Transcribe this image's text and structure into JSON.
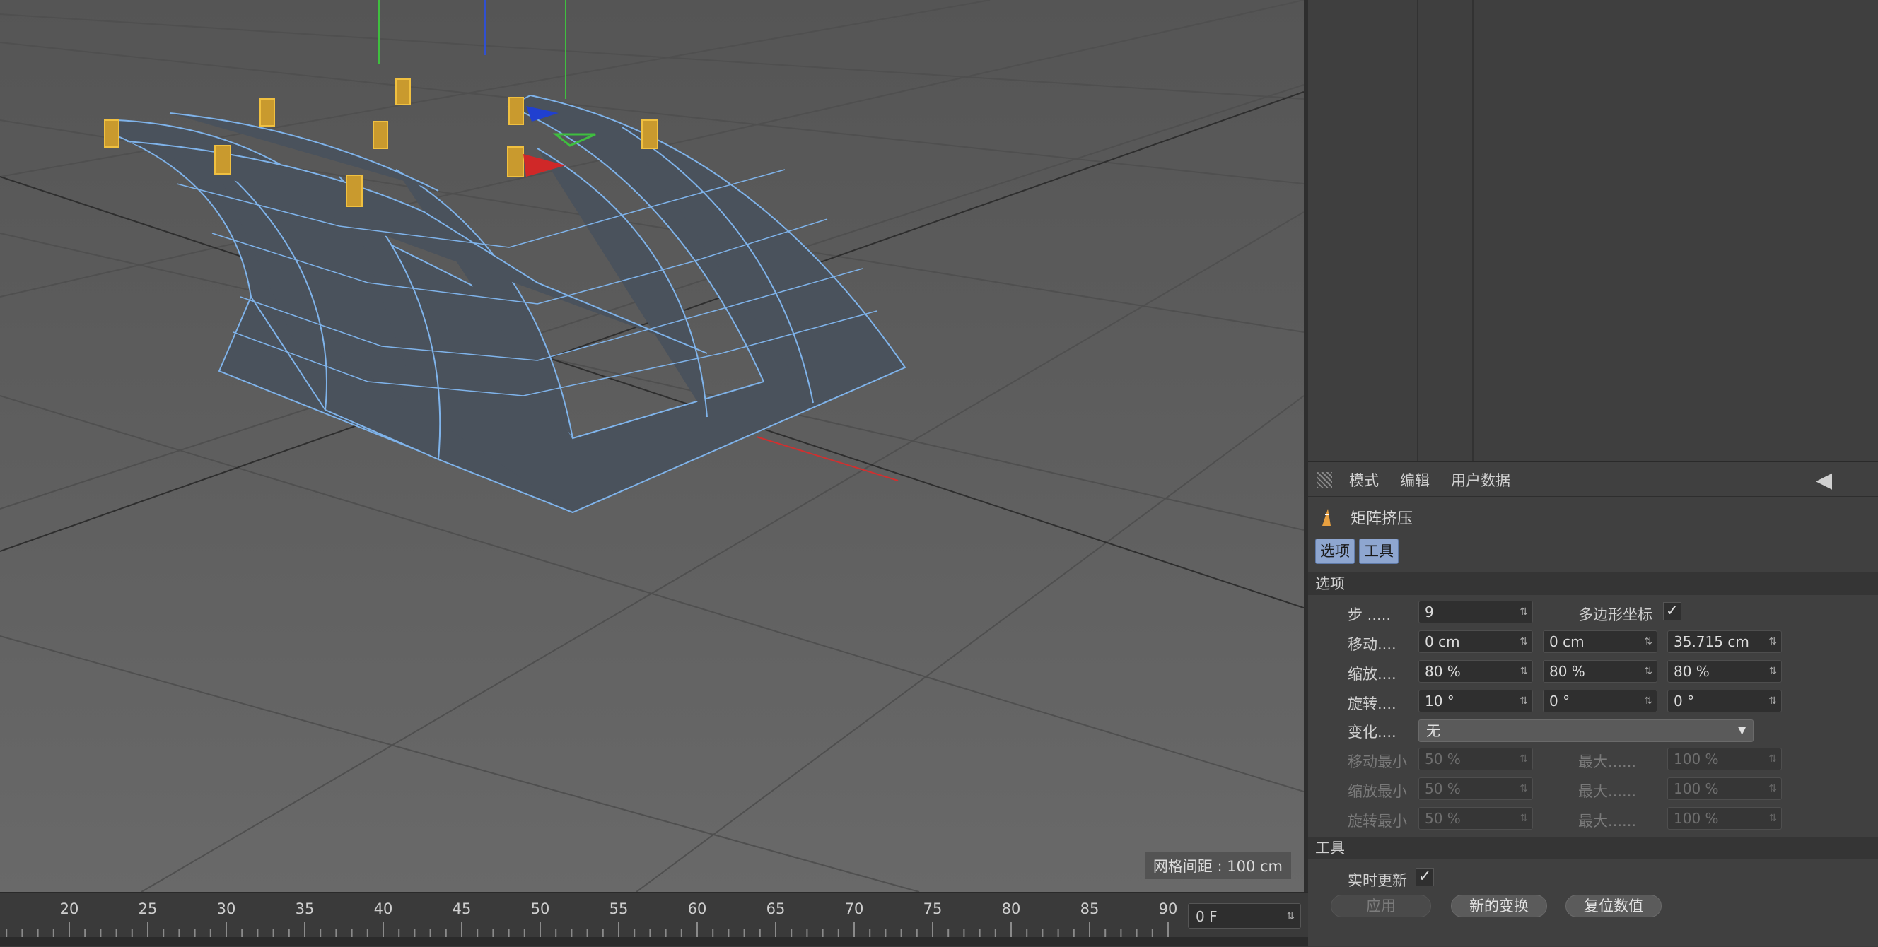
{
  "viewport": {
    "grid_spacing_label": "网格间距 : 100 cm"
  },
  "timeline": {
    "ticks": [
      "20",
      "25",
      "30",
      "35",
      "40",
      "45",
      "50",
      "55",
      "60",
      "65",
      "70",
      "75",
      "80",
      "85",
      "90"
    ],
    "current_frame": "0 F"
  },
  "attributes": {
    "menu": [
      "模式",
      "编辑",
      "用户数据"
    ],
    "object_title": "矩阵挤压",
    "tabs": [
      "选项",
      "工具"
    ],
    "options_header": "选项",
    "steps_label": "步 .....",
    "steps_value": "9",
    "poly_coords_label": "多边形坐标",
    "poly_coords_checked": "✓",
    "move_label": "移动....",
    "move_values": [
      "0 cm",
      "0 cm",
      "35.715 cm"
    ],
    "scale_label": "缩放....",
    "scale_values": [
      "80 %",
      "80 %",
      "80 %"
    ],
    "rotate_label": "旋转....",
    "rotate_values": [
      "10 °",
      "0 °",
      "0 °"
    ],
    "variation_label": "变化....",
    "variation_value": "无",
    "move_min_label": "移动最小",
    "move_min_value": "50 %",
    "scale_min_label": "缩放最小",
    "scale_min_value": "50 %",
    "rotate_min_label": "旋转最小",
    "rotate_min_value": "50 %",
    "max_label": "最大......",
    "max_value": "100 %",
    "tools_header": "工具",
    "realtime_label": "实时更新",
    "realtime_checked": "✓",
    "buttons": [
      "应用",
      "新的变换",
      "复位数值"
    ]
  }
}
